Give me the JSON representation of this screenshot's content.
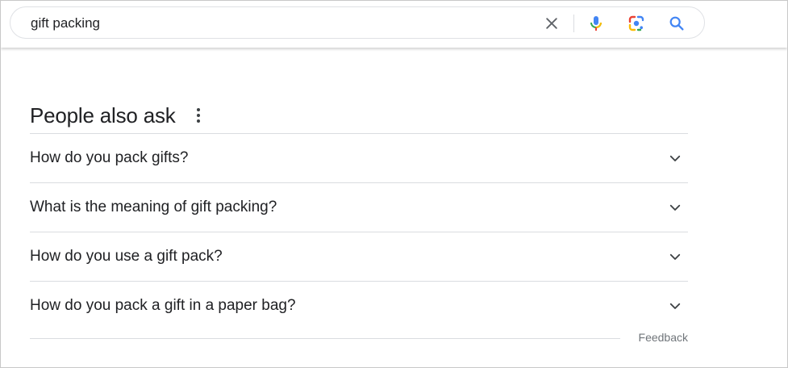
{
  "search": {
    "value": "gift packing",
    "clear_icon": "close-icon",
    "voice_icon": "microphone-icon",
    "lens_icon": "camera-lens-icon",
    "search_icon": "search-icon"
  },
  "colors": {
    "mic_blue": "#4285f4",
    "mic_red": "#ea4335",
    "lens_red": "#ea4335",
    "lens_yellow": "#fbbc04",
    "lens_green": "#34a853",
    "lens_blue": "#4285f4",
    "search_blue": "#4285f4",
    "divider": "#dadce0"
  },
  "paa": {
    "title": "People also ask",
    "more_icon": "more-vert-icon",
    "questions": [
      "How do you pack gifts?",
      "What is the meaning of gift packing?",
      "How do you use a gift pack?",
      "How do you pack a gift in a paper bag?"
    ],
    "expand_icon": "chevron-down-icon"
  },
  "feedback": {
    "label": "Feedback"
  }
}
